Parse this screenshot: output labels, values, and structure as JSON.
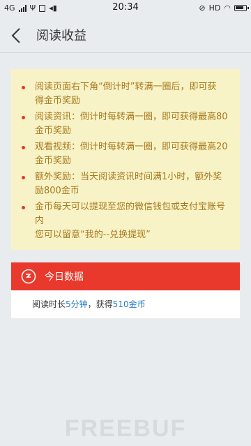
{
  "status_bar": {
    "network": "4G",
    "time": "20:34",
    "hd": "HD",
    "nfc": "N"
  },
  "header": {
    "back_icon": "chevron-left-icon",
    "title": "阅读收益"
  },
  "notice": {
    "bullet_color": "#e23b2e",
    "text_color": "#a6781f",
    "background": "#f8f3c6",
    "items": [
      {
        "line1": "阅读页面右下角“倒计时”转满一圈后，即可获",
        "line2": "得金币奖励"
      },
      {
        "line1": "阅读资讯：倒计时每转满一圈，即可获得最高80",
        "line2": "金币奖励"
      },
      {
        "line1": "观看视频：倒计时每转满一圈，即可获得最高20",
        "line2": "金币奖励"
      },
      {
        "line1": "额外奖励：当天阅读资讯时间满1小时，额外奖",
        "line2": "励800金币"
      },
      {
        "line1": "金币每天可以提现至您的微信钱包或支付宝账号",
        "line2": "内",
        "line3": "您可以留意“我的--兑换提现”"
      }
    ]
  },
  "today": {
    "icon": "clock-icon",
    "title": "今日数据",
    "accent": "#e8392c",
    "read_prefix": "阅读时长",
    "read_value": "5分钟",
    "separator": "，获得",
    "coins_value": "510金币",
    "highlight": "#2b7fc9"
  },
  "watermark": {
    "text": "FREEBUF"
  }
}
